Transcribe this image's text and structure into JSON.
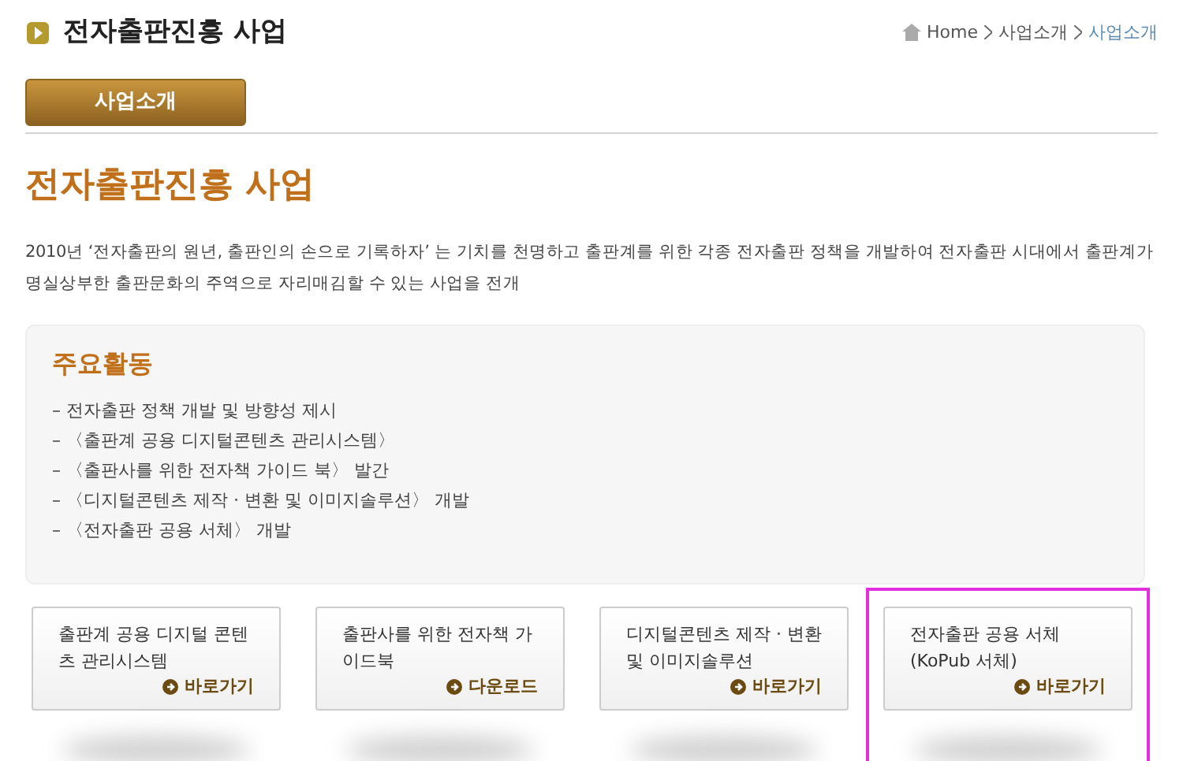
{
  "page_title": "전자출판진흥 사업",
  "breadcrumb": [
    "Home",
    "사업소개",
    "사업소개"
  ],
  "tab": {
    "label": "사업소개",
    "selected": true
  },
  "heading": "전자출판진흥 사업",
  "intro": "2010년 ‘전자출판의 원년, 출판인의 손으로 기록하자’ 는 기치를 천명하고 출판계를 위한 각종 전자출판 정책을 개발하여 전자출판 시대에서 출판계가 명실상부한 출판문화의 주역으로 자리매김할 수 있는 사업을 전개",
  "activities": {
    "title": "주요활동",
    "items": [
      "– 전자출판 정책 개발 및 방향성 제시",
      "– 〈출판계 공용 디지털콘텐츠 관리시스템〉",
      "– 〈출판사를 위한 전자책 가이드 북〉 발간",
      "– 〈디지털콘텐츠 제작 · 변환 및 이미지솔루션〉 개발",
      "– 〈전자출판  공용 서체〉 개발"
    ]
  },
  "cards": [
    {
      "title": "출판계 공용 디지털 콘텐츠 관리시스템",
      "link": "바로가기",
      "selected": false
    },
    {
      "title": "출판사를 위한 전자책 가이드북",
      "link": "다운로드",
      "selected": false
    },
    {
      "title": "디지털콘텐츠 제작  · 변환 및 이미지솔루션",
      "link": "바로가기",
      "selected": false
    },
    {
      "title": "전자출판  공용 서체 (KoPub 서체)",
      "link": "바로가기",
      "selected": true
    }
  ]
}
